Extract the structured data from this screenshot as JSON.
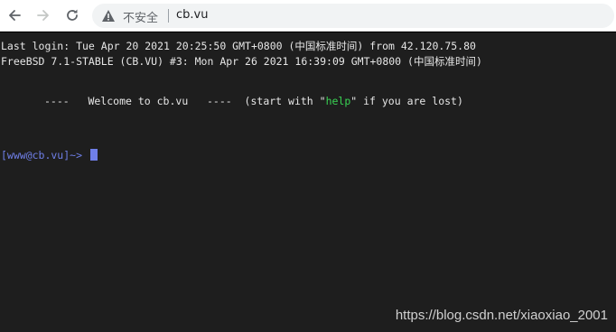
{
  "browser": {
    "security_label": "不安全",
    "url": "cb.vu",
    "icons": {
      "back": "arrow-left-icon",
      "forward": "arrow-right-icon",
      "reload": "reload-icon",
      "security": "warning-triangle-icon"
    }
  },
  "terminal": {
    "line_login": "Last login: Tue Apr 20 2021 20:25:50 GMT+0800 (中国标准时间) from 42.120.75.80",
    "line_os": "FreeBSD 7.1-STABLE (CB.VU) #3: Mon Apr 26 2021 16:39:09 GMT+0800 (中国标准时间)",
    "welcome_prefix": "----   Welcome to cb.vu   ----  (start with \"",
    "welcome_help": "help",
    "welcome_suffix": "\" if you are lost)",
    "prompt": "[www@cb.vu]~> "
  },
  "colors": {
    "terminal_bg": "#1e1e1e",
    "terminal_fg": "#e6e6e6",
    "prompt": "#6f7fe8",
    "help_highlight": "#39d353"
  },
  "watermark": "https://blog.csdn.net/xiaoxiao_2001"
}
